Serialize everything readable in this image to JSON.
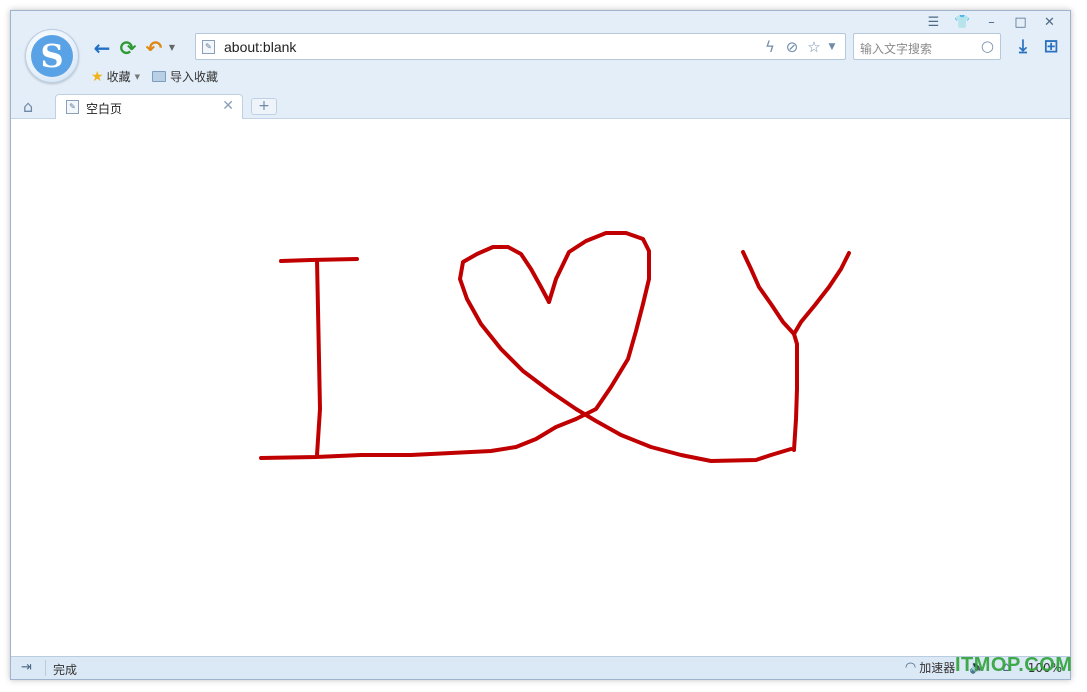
{
  "window_controls": {
    "menu_icon": "menu-icon",
    "skin_icon": "shirt-icon",
    "minimize_icon": "minimize-icon",
    "maximize_icon": "maximize-icon",
    "close_icon": "close-icon"
  },
  "address_bar": {
    "url": "about:blank"
  },
  "search": {
    "placeholder": "输入文字搜索"
  },
  "bookmarks": {
    "favorites_label": "收藏",
    "import_label": "导入收藏"
  },
  "tabs": [
    {
      "label": "空白页"
    }
  ],
  "content": {
    "drawing_color": "#c00000",
    "drawing_description_icon": "handwriting"
  },
  "status_bar": {
    "status_text": "完成",
    "accelerator_label": "加速器",
    "zoom_label": "100%"
  },
  "watermark": {
    "text": "ITMOP.COM"
  },
  "colors": {
    "chrome_bg": "#e4eef8",
    "accent_blue": "#2170c4",
    "refresh_green": "#2e9a33",
    "undo_orange": "#e08613",
    "watermark_green": "#2fa339"
  }
}
